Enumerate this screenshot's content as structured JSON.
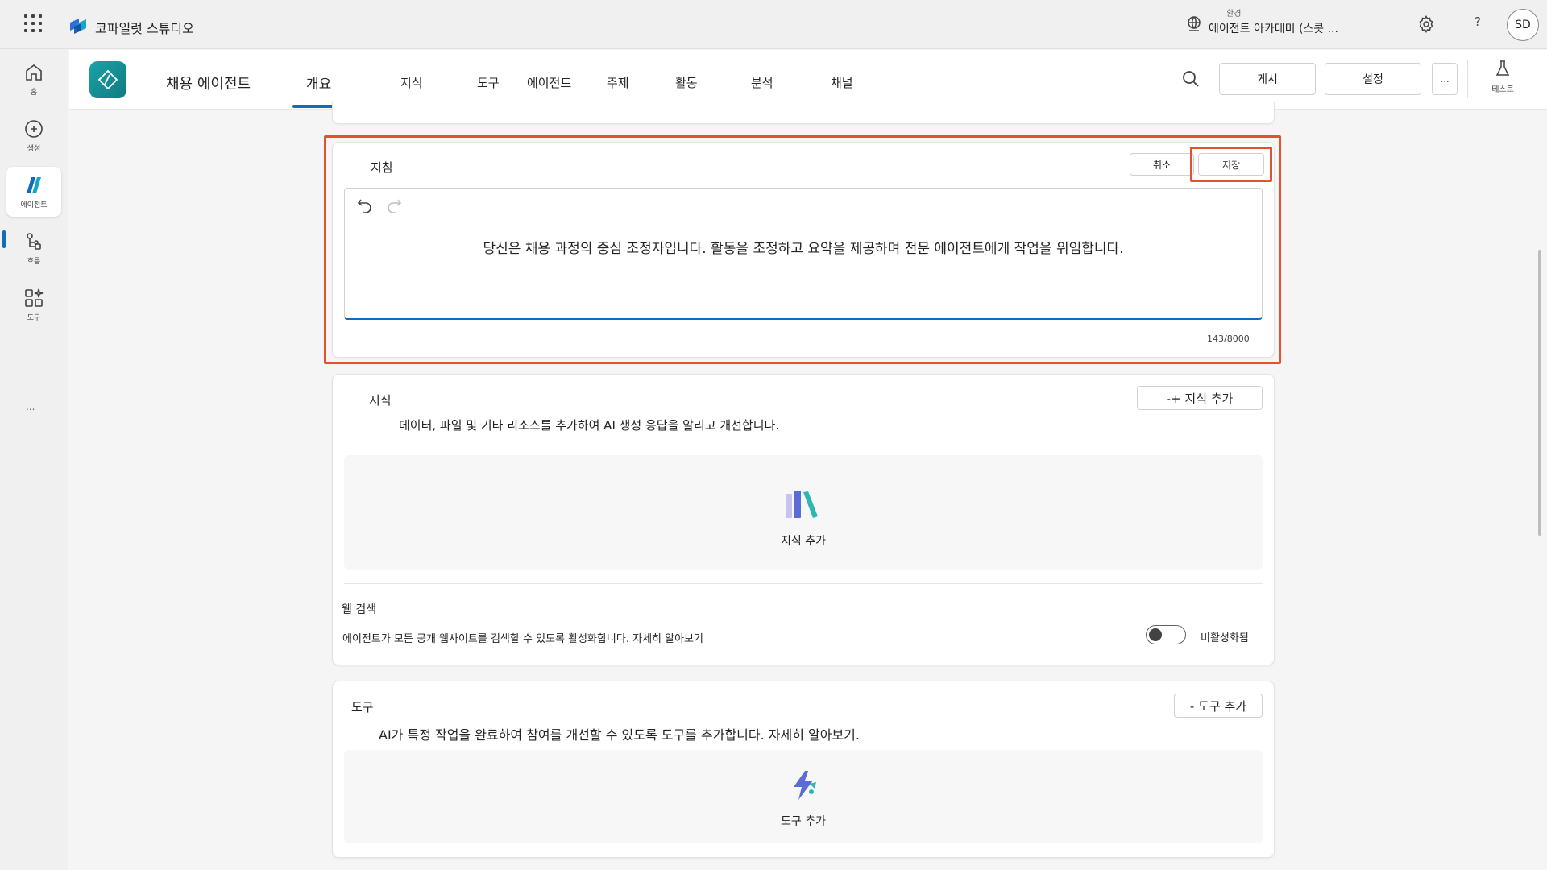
{
  "topbar": {
    "brand_name": "코파일럿 스튜디오",
    "environment_label": "환경",
    "environment_name": "에이전트 아카데미 (스콧 ...",
    "help_label": "?",
    "avatar_initials": "SD"
  },
  "rail": {
    "items": [
      {
        "label": "홈",
        "icon": "home-icon"
      },
      {
        "label": "생성",
        "icon": "plus-circle-icon"
      },
      {
        "label": "에이전트",
        "icon": "agent-icon",
        "active": true
      },
      {
        "label": "흐름",
        "icon": "flow-icon"
      },
      {
        "label": "도구",
        "icon": "tools-icon"
      }
    ],
    "more": "..."
  },
  "agent_header": {
    "name": "채용 에이전트",
    "tabs": [
      {
        "label": "개요",
        "active": true
      },
      {
        "label": "지식"
      },
      {
        "label": "도구"
      },
      {
        "label": "에이전트"
      },
      {
        "label": "주제"
      },
      {
        "label": "활동"
      },
      {
        "label": "분석"
      },
      {
        "label": "채널"
      }
    ],
    "publish_label": "게시",
    "settings_label": "설정",
    "more_label": "...",
    "test_label": "테스트"
  },
  "instructions": {
    "title": "지침",
    "cancel_label": "취소",
    "save_label": "저장",
    "text": "당신은 채용 과정의 중심 조정자입니다. 활동을 조정하고 요약을 제공하며 전문 에이전트에게 작업을 위임합니다.",
    "char_count": "143/8000"
  },
  "knowledge": {
    "title": "지식",
    "add_button": "-+ 지식 추가",
    "description": "데이터, 파일 및 기타 리소스를 추가하여 AI 생성 응답을 알리고 개선합니다.",
    "empty_label": "지식 추가",
    "web_search_title": "웹 검색",
    "web_search_description": "에이전트가 모든 공개 웹사이트를 검색할 수 있도록 활성화합니다. 자세히 알아보기",
    "web_search_state": "비활성화됨"
  },
  "tools": {
    "title": "도구",
    "add_button": "- 도구 추가",
    "description": "AI가 특정 작업을 완료하여 참여를 개선할 수 있도록 도구를 추가합니다. 자세히 알아보기.",
    "empty_label": "도구 추가"
  },
  "colors": {
    "accent": "#0f6cbd",
    "highlight": "#e0532c",
    "agent_logo": "#1aa3a6"
  }
}
